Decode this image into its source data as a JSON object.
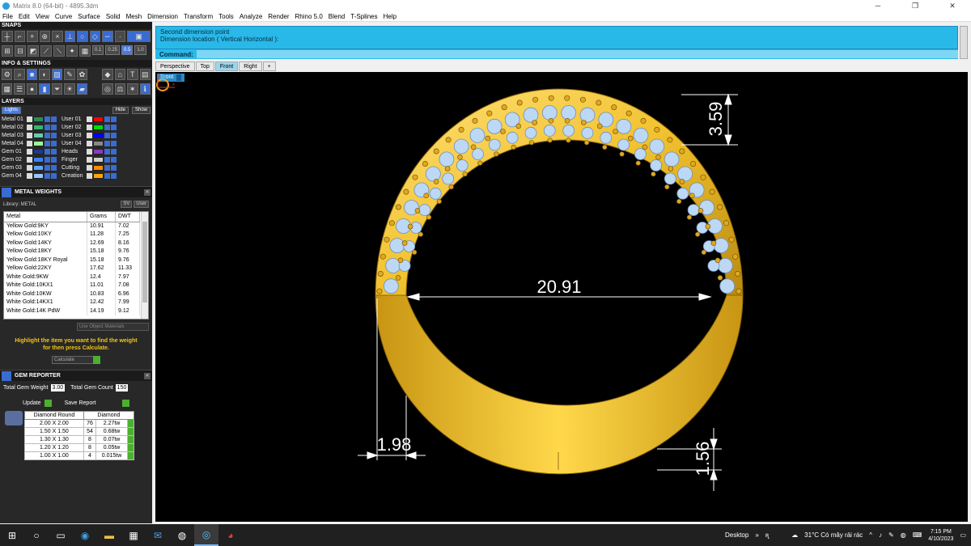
{
  "window": {
    "title": "Matrix 8.0 (64-bit) - 4895.3dm",
    "minimize": "─",
    "restore": "❐",
    "close": "✕"
  },
  "menu": [
    "File",
    "Edit",
    "View",
    "Curve",
    "Surface",
    "Solid",
    "Mesh",
    "Dimension",
    "Transform",
    "Tools",
    "Analyze",
    "Render",
    "Rhino 5.0",
    "Blend",
    "T-Splines",
    "Help"
  ],
  "panels": {
    "snaps": "SNAPS",
    "snap_values": [
      "0.1",
      "0.25",
      "0.5",
      "1.0"
    ],
    "info_settings": "INFO & SETTINGS",
    "layers": "LAYERS",
    "layers_lights": "Lights",
    "layers_hide": "Hide",
    "layers_show": "Show",
    "layers_left": [
      {
        "name": "Metal 01",
        "color": "#2e8b57"
      },
      {
        "name": "Metal 02",
        "color": "#3cb371"
      },
      {
        "name": "Metal 03",
        "color": "#66cdaa"
      },
      {
        "name": "Metal 04",
        "color": "#98fb98"
      },
      {
        "name": "Gem 01",
        "color": "#1e3a8a"
      },
      {
        "name": "Gem 02",
        "color": "#3b82f6"
      },
      {
        "name": "Gem 03",
        "color": "#60a5fa"
      },
      {
        "name": "Gem 04",
        "color": "#93c5fd"
      }
    ],
    "layers_right": [
      {
        "name": "User 01",
        "color": "#ff0000"
      },
      {
        "name": "User 02",
        "color": "#00dd00"
      },
      {
        "name": "User 03",
        "color": "#0000ff"
      },
      {
        "name": "User 04",
        "color": "#888888"
      },
      {
        "name": "Heads",
        "color": "#8b3bbf"
      },
      {
        "name": "Finger",
        "color": "#cfcfcf"
      },
      {
        "name": "Cutting",
        "color": "#ff8c00"
      },
      {
        "name": "Creation",
        "color": "#ffa500"
      }
    ]
  },
  "metal_weights": {
    "title": "METAL WEIGHTS",
    "library": "Library: METAL",
    "library_sv": "SV",
    "library_user": "User",
    "columns": [
      "Metal",
      "Grams",
      "DWT"
    ],
    "rows": [
      [
        "Yellow Gold:9KY",
        "10.91",
        "7.02"
      ],
      [
        "Yellow Gold:10KY",
        "11.28",
        "7.25"
      ],
      [
        "Yellow Gold:14KY",
        "12.69",
        "8.16"
      ],
      [
        "Yellow Gold:18KY",
        "15.18",
        "9.76"
      ],
      [
        "Yellow Gold:18KY Royal",
        "15.18",
        "9.76"
      ],
      [
        "Yellow Gold:22KY",
        "17.62",
        "11.33"
      ],
      [
        "White Gold:9KW",
        "12.4",
        "7.97"
      ],
      [
        "White Gold:10KX1",
        "11.01",
        "7.08"
      ],
      [
        "White Gold:10KW",
        "10.83",
        "6.96"
      ],
      [
        "White Gold:14KX1",
        "12.42",
        "7.99"
      ],
      [
        "White Gold:14K PdW",
        "14.19",
        "9.12"
      ]
    ],
    "use_object_materials": "Use Object Materials",
    "hint_line1": "Highlight the item you want to find the weight",
    "hint_line2": "for then press Calculate.",
    "calculate": "Calculate"
  },
  "gem_reporter": {
    "title": "GEM REPORTER",
    "total_weight_label": "Total Gem Weight",
    "total_weight": "3.00",
    "total_count_label": "Total Gem Count",
    "total_count": "150",
    "update": "Update",
    "save_report": "Save Report",
    "columns": [
      "Diamond Round",
      "Diamond"
    ],
    "rows": [
      [
        "2.00 X 2.00",
        "76",
        "2.27tw"
      ],
      [
        "1.50 X 1.50",
        "54",
        "0.68tw"
      ],
      [
        "1.30 X 1.30",
        "8",
        "0.07tw"
      ],
      [
        "1.20 X 1.20",
        "8",
        "0.05tw"
      ],
      [
        "1.00 X 1.00",
        "4",
        "0.015tw"
      ]
    ]
  },
  "command": {
    "line1": "Second dimension point",
    "line2": "Dimension location ( Vertical  Horizontal ):",
    "prompt": "Command:"
  },
  "viewport_tabs": [
    "Perspective",
    "Top",
    "Front",
    "Right",
    "+"
  ],
  "active_tab": "Front",
  "viewport_label": "Front",
  "dimensions": {
    "diameter": "20.91",
    "top_thickness": "3.59",
    "band_width": "1.98",
    "bottom_thickness": "1.56"
  },
  "colors": {
    "gold": "#f2c12e",
    "gold_dark": "#b98a10",
    "gem": "#bcd8f4",
    "cmd_bg": "#29b9e8",
    "hint": "#f3c318"
  },
  "taskbar": {
    "desktop": "Desktop",
    "weather": "31°C  Có mây rải rác",
    "time": "7:15 PM",
    "date": "4/10/2023"
  }
}
